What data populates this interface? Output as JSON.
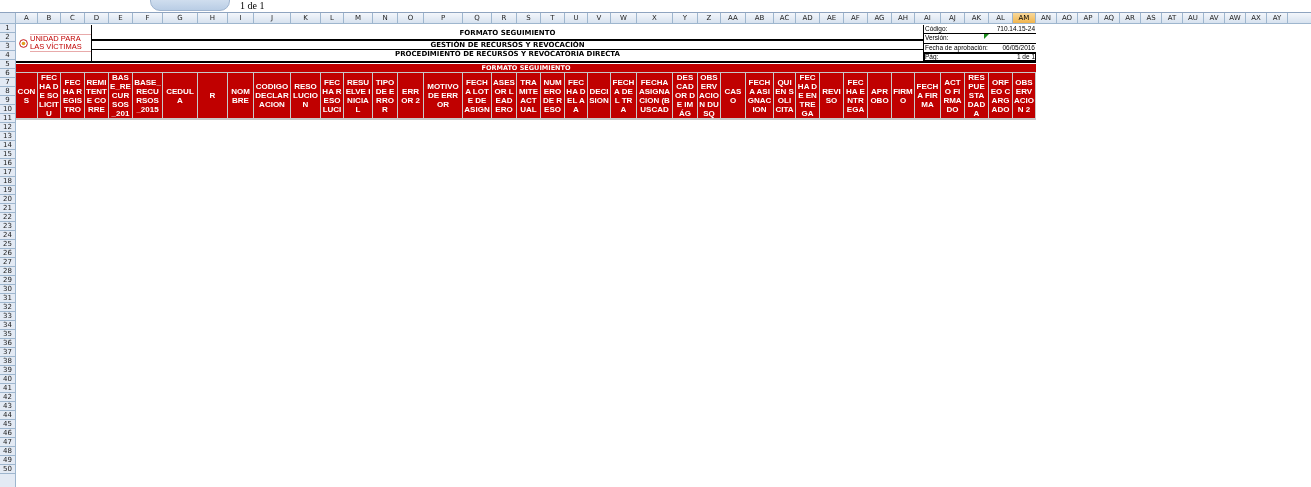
{
  "top_strip": {
    "page_indicator": "1 de 1"
  },
  "column_letters": [
    {
      "label": "A",
      "selected": false
    },
    {
      "label": "B",
      "selected": false
    },
    {
      "label": "C",
      "selected": false
    },
    {
      "label": "D",
      "selected": false
    },
    {
      "label": "E",
      "selected": false
    },
    {
      "label": "F",
      "selected": false
    },
    {
      "label": "G",
      "selected": false
    },
    {
      "label": "H",
      "selected": false
    },
    {
      "label": "I",
      "selected": false
    },
    {
      "label": "J",
      "selected": false
    },
    {
      "label": "K",
      "selected": false
    },
    {
      "label": "L",
      "selected": false
    },
    {
      "label": "M",
      "selected": false
    },
    {
      "label": "N",
      "selected": false
    },
    {
      "label": "O",
      "selected": false
    },
    {
      "label": "P",
      "selected": false
    },
    {
      "label": "Q",
      "selected": false
    },
    {
      "label": "R",
      "selected": false
    },
    {
      "label": "S",
      "selected": false
    },
    {
      "label": "T",
      "selected": false
    },
    {
      "label": "U",
      "selected": false
    },
    {
      "label": "V",
      "selected": false
    },
    {
      "label": "W",
      "selected": false
    },
    {
      "label": "X",
      "selected": false
    },
    {
      "label": "Y",
      "selected": false
    },
    {
      "label": "Z",
      "selected": false
    },
    {
      "label": "AA",
      "selected": false
    },
    {
      "label": "AB",
      "selected": false
    },
    {
      "label": "AC",
      "selected": false
    },
    {
      "label": "AD",
      "selected": false
    },
    {
      "label": "AE",
      "selected": false
    },
    {
      "label": "AF",
      "selected": false
    },
    {
      "label": "AG",
      "selected": false
    },
    {
      "label": "AH",
      "selected": false
    },
    {
      "label": "AI",
      "selected": false
    },
    {
      "label": "AJ",
      "selected": false
    },
    {
      "label": "AK",
      "selected": false
    },
    {
      "label": "AL",
      "selected": false
    },
    {
      "label": "AM",
      "selected": true
    },
    {
      "label": "AN",
      "selected": false
    },
    {
      "label": "AO",
      "selected": false
    },
    {
      "label": "AP",
      "selected": false
    },
    {
      "label": "AQ",
      "selected": false
    },
    {
      "label": "AR",
      "selected": false
    },
    {
      "label": "AS",
      "selected": false
    },
    {
      "label": "AT",
      "selected": false
    },
    {
      "label": "AU",
      "selected": false
    },
    {
      "label": "AV",
      "selected": false
    },
    {
      "label": "AW",
      "selected": false
    },
    {
      "label": "AX",
      "selected": false
    },
    {
      "label": "AY",
      "selected": false
    }
  ],
  "row_numbers": [
    "1",
    "2",
    "3",
    "4",
    "5",
    "6",
    "7",
    "8",
    "9",
    "10",
    "11",
    "12",
    "13",
    "14",
    "15",
    "16",
    "17",
    "18",
    "19",
    "20",
    "21",
    "22",
    "23",
    "24",
    "25",
    "26",
    "27",
    "28",
    "29",
    "30",
    "31",
    "32",
    "33",
    "34",
    "35",
    "36",
    "37",
    "38",
    "39",
    "40",
    "41",
    "42",
    "43",
    "44",
    "45",
    "46",
    "47",
    "48",
    "49",
    "50"
  ],
  "logo": {
    "text": "UNIDAD PARA LAS VÍCTIMAS"
  },
  "titles": [
    "FORMATO SEGUIMIENTO",
    "GESTIÓN DE RECURSOS Y REVOCACIÓN",
    "PROCEDIMIENTO DE RECURSOS Y REVOCATORIA DIRECTA"
  ],
  "info_box": [
    {
      "label": "Código:",
      "value": "710.14.15-24",
      "comment": false,
      "selected": false
    },
    {
      "label": "Versión:",
      "comment": true,
      "selected": false
    },
    {
      "label": "Fecha de aprobación:",
      "value": "06/05/2016",
      "comment": false,
      "selected": false
    },
    {
      "label": "Pág:",
      "value": "1 de 1",
      "comment": false,
      "selected": true
    }
  ],
  "banner": "FORMATO SEGUIMIENTO",
  "table": {
    "columns": [
      "CONS",
      "FECHA DE SOLICITU",
      "FECHA REGISTRO",
      "REMITENTE CORRE",
      "BASE_RECURSOS_201",
      "BASE_RECURSOS_2015",
      "CEDULA",
      "R",
      "NOMBRE",
      "CODIGO DECLARACION",
      "RESOLUCION",
      "FECHA RESOLUCI",
      "RESUELVE INICIAL",
      "TIPO DE ERROR",
      "ERROR 2",
      "MOTIVO DE ERROR",
      "FECHA LOTE DE ASIGN",
      "ASESOR LEADERO",
      "TRAMITE ACTUAL",
      "NUMERO DE RESO",
      "FECHA DEL AA",
      "DECISION",
      "FECHA DEL TRA",
      "FECHA ASIGNACION (BUSCAD",
      "DESCADOR DE IMÁG",
      "OBSERVACION DUSQ",
      "CASO",
      "FECHA ASIGNACION",
      "QUIEN SOLICITA",
      "FECHA DE ENTREGA",
      "REVISO",
      "FECHA ENTREGA",
      "APROBO",
      "FIRMO",
      "FECHA FIRMA",
      "ACTO FIRMADO",
      "RESPUESTA DADA",
      "ORFEO CARGADO",
      "OBSERVACION 2"
    ]
  }
}
